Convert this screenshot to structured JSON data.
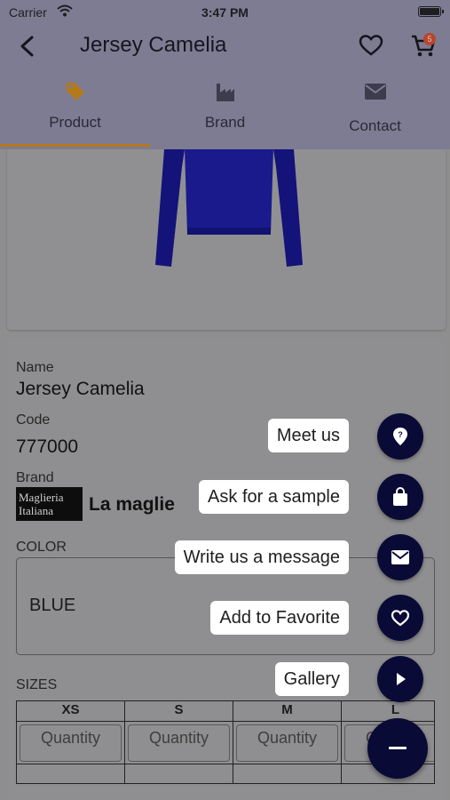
{
  "status_bar": {
    "carrier": "Carrier",
    "time": "3:47 PM"
  },
  "header": {
    "title": "Jersey Camelia",
    "cart_count": "5",
    "tabs": [
      {
        "label": "Product",
        "icon": "tag-icon",
        "active": true
      },
      {
        "label": "Brand",
        "icon": "factory-icon",
        "active": false
      },
      {
        "label": "Contact",
        "icon": "mail-icon",
        "active": false
      }
    ]
  },
  "product": {
    "name_label": "Name",
    "name": "Jersey Camelia",
    "code_label": "Code",
    "code": "777000",
    "brand_label": "Brand",
    "brand_logo_text": "Maglieria Italiana",
    "brand_name": "La maglie",
    "color_label": "COLOR",
    "color_value": "BLUE",
    "sizes_label": "SIZES",
    "sizes": [
      "XS",
      "S",
      "M",
      "L"
    ],
    "quantity_placeholder": "Quantity"
  },
  "fab_menu": {
    "items": [
      {
        "label": "Meet us",
        "icon": "location-pin-icon"
      },
      {
        "label": "Ask for a sample",
        "icon": "shopping-bag-icon"
      },
      {
        "label": "Write us a message",
        "icon": "envelope-icon"
      },
      {
        "label": "Add to Favorite",
        "icon": "heart-icon"
      },
      {
        "label": "Gallery",
        "icon": "play-icon"
      }
    ],
    "main_icon": "minus-icon"
  },
  "colors": {
    "header_bg": "#7e7c92",
    "tab_indicator": "#b37a1c",
    "fab_bg": "#0a0a36",
    "cart_badge": "#b5472e"
  }
}
